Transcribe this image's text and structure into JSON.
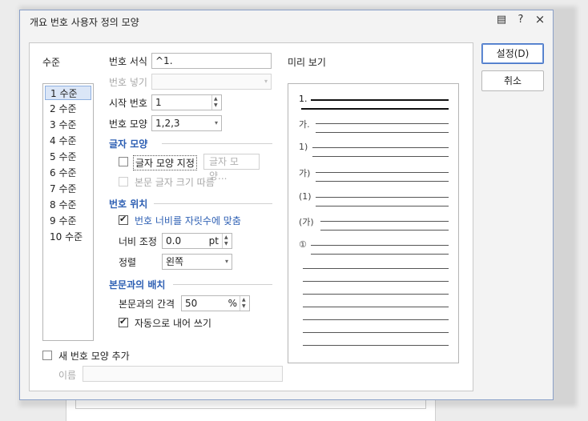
{
  "dialog": {
    "title": "개요 번호 사용자 정의 모양",
    "icons": [
      "comment-icon",
      "help-icon",
      "close-icon"
    ],
    "icon_glyphs": {
      "comment": "▤",
      "help": "?",
      "close": "×"
    }
  },
  "buttons": {
    "ok": "설정(D)",
    "cancel": "취소"
  },
  "levels": {
    "header": "수준",
    "items": [
      "1 수준",
      "2 수준",
      "3 수준",
      "4 수준",
      "5 수준",
      "6 수준",
      "7 수준",
      "8 수준",
      "9 수준",
      "10 수준"
    ],
    "selected": "1 수준"
  },
  "format": {
    "label": "번호 서식",
    "value": "^1.",
    "insert_label": "번호 넣기",
    "insert_value": "",
    "start_label": "시작 번호",
    "start_value": "1",
    "shape_label": "번호 모양",
    "shape_value": "1,2,3"
  },
  "char_shape": {
    "header": "글자 모양",
    "specify_label": "글자 모양 지정",
    "specify_checked": false,
    "button_label": "글자 모양...",
    "follow_label": "본문 글자 크기 따름",
    "follow_checked": false
  },
  "position": {
    "header": "번호 위치",
    "fit_label": "번호 너비를 자릿수에 맞춤",
    "fit_checked": true,
    "width_label": "너비 조정",
    "width_value": "0.0",
    "width_unit": "pt",
    "align_label": "정렬",
    "align_value": "왼쪽"
  },
  "body_layout": {
    "header": "본문과의 배치",
    "gap_label": "본문과의 간격",
    "gap_value": "50",
    "gap_unit": "%",
    "auto_label": "자동으로 내어 쓰기",
    "auto_checked": true
  },
  "preview": {
    "header": "미리 보기",
    "labels": [
      "1.",
      "가.",
      "1)",
      "가)",
      "(1)",
      "(가)",
      "①"
    ]
  },
  "new_shape": {
    "label": "새 번호 모양 추가",
    "checked": false,
    "name_label": "이름",
    "name_value": ""
  },
  "colors": {
    "accent": "#2d5fb3",
    "selection": "#dbe6f7",
    "border": "#8aa0c8"
  }
}
